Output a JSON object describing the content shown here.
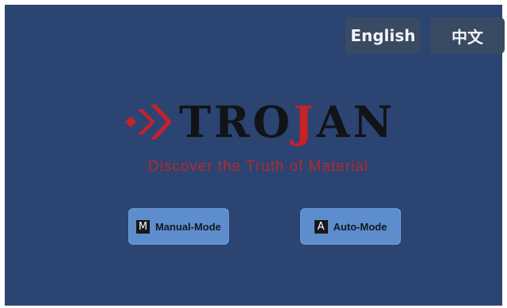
{
  "language": {
    "english_label": "English",
    "chinese_label": "中文"
  },
  "logo": {
    "brand_before": "TRO",
    "brand_highlight": "J",
    "brand_after": "AN",
    "tagline": "Discover the Truth of Material"
  },
  "modes": {
    "manual": {
      "icon_letter": "M",
      "label": "Manual-Mode"
    },
    "auto": {
      "icon_letter": "A",
      "label": "Auto-Mode"
    }
  },
  "colors": {
    "background": "#2b4471",
    "brand_red": "#c62228",
    "mode_button": "#5d8dcc",
    "language_button": "#3a4a63"
  }
}
